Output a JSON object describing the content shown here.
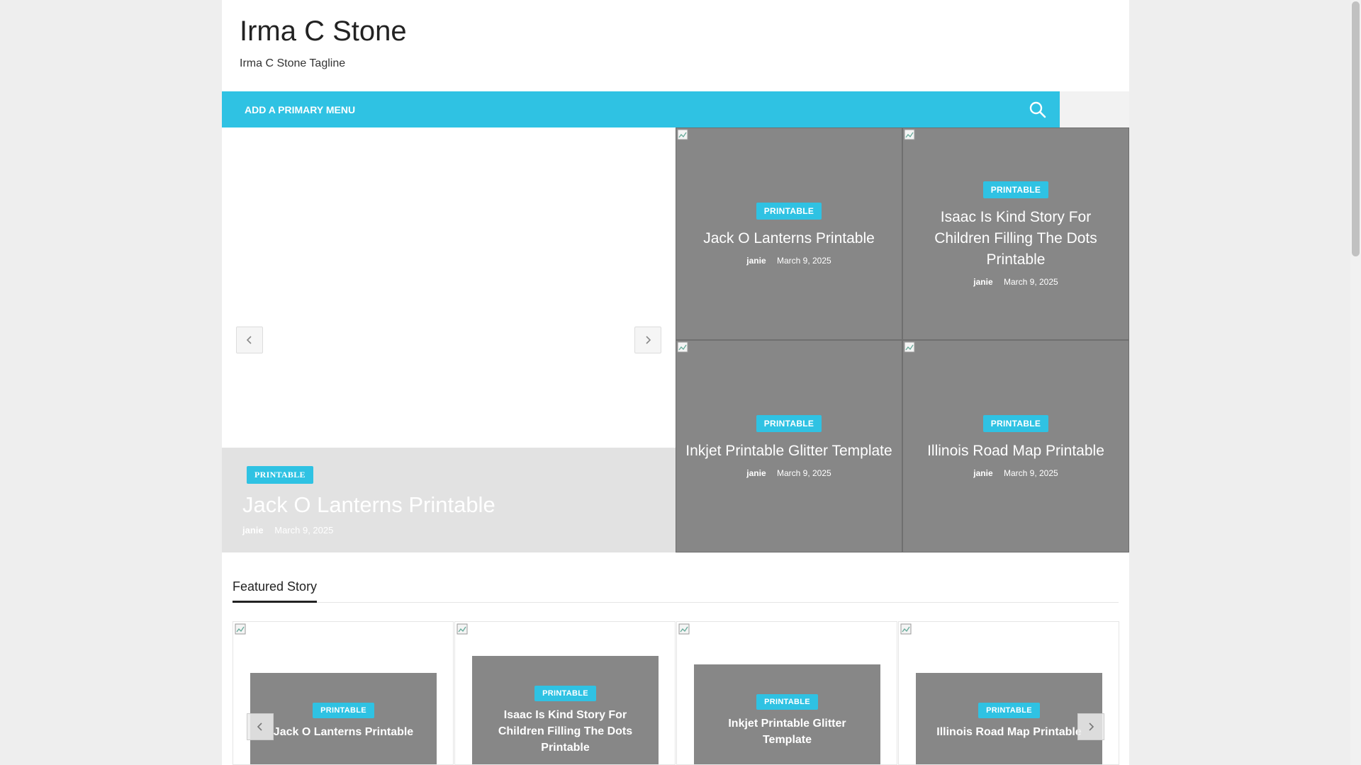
{
  "site": {
    "title": "Irma C Stone",
    "tagline": "Irma C Stone Tagline"
  },
  "nav": {
    "menu_label": "ADD A PRIMARY MENU",
    "search_icon": "search-icon"
  },
  "slider": {
    "category": "PRINTABLE",
    "title": "Jack O Lanterns Printable",
    "author": "janie",
    "date": "March 9, 2025"
  },
  "grid": [
    {
      "category": "PRINTABLE",
      "title": "Jack O Lanterns Printable",
      "author": "janie",
      "date": "March 9, 2025"
    },
    {
      "category": "PRINTABLE",
      "title": "Isaac Is Kind Story For Children Filling The Dots Printable",
      "author": "janie",
      "date": "March 9, 2025"
    },
    {
      "category": "PRINTABLE",
      "title": "Inkjet Printable Glitter Template",
      "author": "janie",
      "date": "March 9, 2025"
    },
    {
      "category": "PRINTABLE",
      "title": "Illinois Road Map Printable",
      "author": "janie",
      "date": "March 9, 2025"
    }
  ],
  "featured": {
    "heading": "Featured Story",
    "items": [
      {
        "category": "PRINTABLE",
        "title": "Jack O Lanterns Printable"
      },
      {
        "category": "PRINTABLE",
        "title": "Isaac Is Kind Story For Children Filling The Dots Printable"
      },
      {
        "category": "PRINTABLE",
        "title": "Inkjet Printable Glitter Template"
      },
      {
        "category": "PRINTABLE",
        "title": "Illinois Road Map Printable"
      }
    ]
  },
  "colors": {
    "accent": "#2fc2e3",
    "tile_bg": "#878787",
    "caption_bg": "#e2e2e2"
  }
}
